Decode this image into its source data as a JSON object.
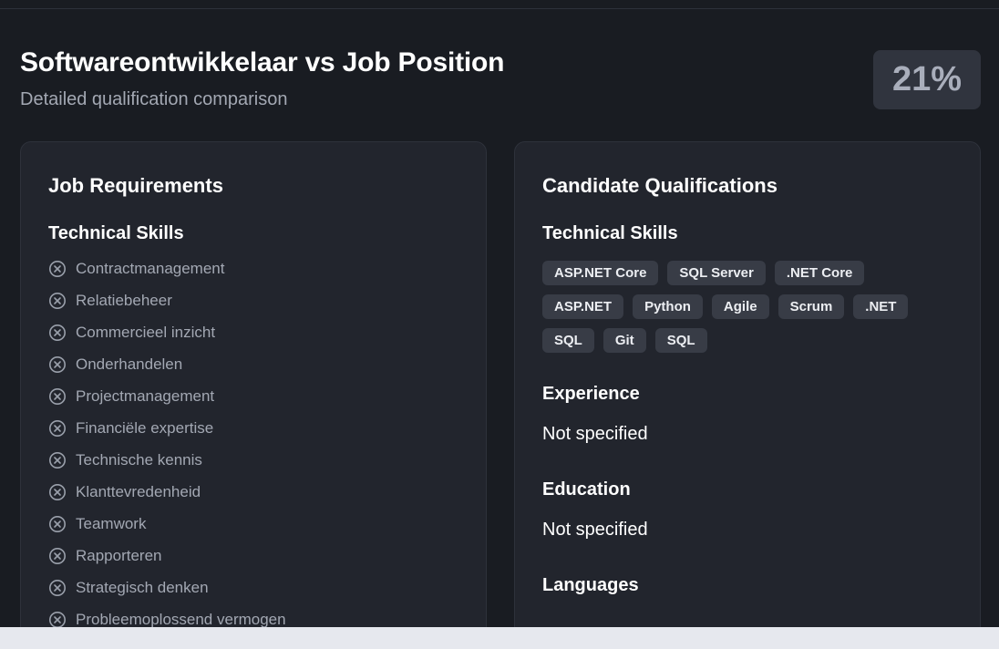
{
  "header": {
    "title": "Softwareontwikkelaar vs Job Position",
    "subtitle": "Detailed qualification comparison",
    "match_score": "21%"
  },
  "job_requirements": {
    "title": "Job Requirements",
    "technical_skills_title": "Technical Skills",
    "skills": [
      "Contractmanagement",
      "Relatiebeheer",
      "Commercieel inzicht",
      "Onderhandelen",
      "Projectmanagement",
      "Financiële expertise",
      "Technische kennis",
      "Klanttevredenheid",
      "Teamwork",
      "Rapporteren",
      "Strategisch denken",
      "Probleemoplossend vermogen"
    ],
    "skill_status_icon": "x-circle-icon"
  },
  "candidate": {
    "title": "Candidate Qualifications",
    "technical_skills_title": "Technical Skills",
    "tag_rows": [
      [
        "ASP.NET Core",
        "SQL Server",
        ".NET Core"
      ],
      [
        "ASP.NET",
        "Python",
        "Agile",
        "Scrum",
        ".NET"
      ],
      [
        "SQL",
        "Git",
        "SQL"
      ]
    ],
    "experience_title": "Experience",
    "experience_value": "Not specified",
    "education_title": "Education",
    "education_value": "Not specified",
    "languages_title": "Languages"
  },
  "colors": {
    "background": "#191c22",
    "panel": "#22252d",
    "tag": "#383c46",
    "muted_text": "#a3a8b3"
  }
}
